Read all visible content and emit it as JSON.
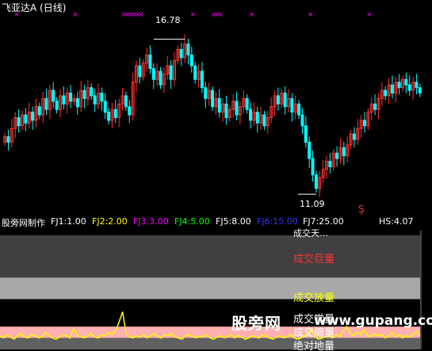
{
  "header": {
    "title": "飞亚达A (日线)"
  },
  "annotations": {
    "high": "16.78",
    "low": "11.09"
  },
  "fj_bar": {
    "items": [
      {
        "text": "股旁网制作",
        "color": "#ffffff"
      },
      {
        "text": "FJ1:1.00",
        "color": "#ffffff"
      },
      {
        "text": "FJ2:2.00",
        "color": "#ffff00"
      },
      {
        "text": "FJ3:3.00",
        "color": "#ff00ff"
      },
      {
        "text": "FJ4:5.00",
        "color": "#00ff00"
      },
      {
        "text": "FJ5:8.00",
        "color": "#ffffff"
      },
      {
        "text": "FJ6:15.00",
        "color": "#3333ff"
      },
      {
        "text": "FJ7:25.00",
        "color": "#ffffff"
      },
      {
        "text": "HS:4.07",
        "color": "#ffffff"
      }
    ]
  },
  "indicator": {
    "labels": {
      "top_partial": "成交天…",
      "huge_volume": "成交巨量",
      "expand_volume": "成交放量",
      "normal_volume": "成交常量",
      "shrink_volume": "成交缩量",
      "absolute_low": "绝对地量"
    }
  },
  "watermark": {
    "text1": "股旁网",
    "text2": "www.gupang.com"
  },
  "colors": {
    "up": "#ff3333",
    "down": "#00ffff",
    "marker": "#ff00ff",
    "line": "#ffff00",
    "band_dark": "#404040",
    "band_light": "#a8a8a8",
    "band_pink": "#ffb0b0"
  },
  "chart_data": [
    {
      "type": "candlestick",
      "title": "飞亚达A (日线)",
      "annotated_high": 16.78,
      "annotated_low": 11.09,
      "ylim": [
        10.6,
        17.4
      ],
      "close": [
        13.2,
        13.0,
        13.5,
        13.9,
        13.6,
        14.0,
        13.7,
        14.1,
        13.8,
        14.3,
        14.0,
        14.6,
        14.2,
        14.9,
        14.5,
        14.2,
        14.7,
        14.4,
        14.8,
        14.5,
        14.6,
        14.3,
        14.9,
        14.6,
        15.0,
        14.7,
        14.4,
        14.8,
        14.5,
        14.1,
        13.8,
        14.2,
        13.9,
        14.4,
        14.7,
        14.3,
        14.0,
        15.2,
        15.8,
        15.4,
        15.9,
        16.2,
        15.7,
        15.3,
        15.6,
        15.1,
        15.5,
        15.8,
        15.3,
        16.0,
        16.4,
        16.1,
        16.6,
        16.2,
        15.8,
        15.3,
        15.6,
        15.0,
        14.6,
        14.9,
        14.3,
        14.6,
        14.1,
        14.4,
        13.9,
        14.2,
        14.5,
        14.0,
        14.3,
        14.6,
        14.2,
        13.8,
        14.1,
        13.7,
        14.0,
        13.6,
        13.9,
        14.3,
        14.7,
        14.4,
        14.8,
        14.3,
        14.6,
        14.1,
        14.4,
        14.0,
        13.6,
        13.0,
        12.4,
        11.8,
        11.3,
        11.7,
        12.0,
        12.3,
        12.1,
        12.6,
        12.4,
        12.8,
        12.5,
        12.9,
        13.3,
        13.1,
        13.5,
        13.8,
        13.6,
        14.1,
        14.4,
        14.2,
        14.6,
        14.9,
        14.7,
        15.1,
        14.8,
        15.2,
        15.0,
        15.3,
        15.1,
        14.9,
        15.2,
        15.0,
        14.8
      ]
    },
    {
      "type": "line",
      "name": "成交量指标",
      "ylim": [
        0,
        10
      ],
      "bands": [
        {
          "label": "成交巨量",
          "from": 6.3,
          "to": 10
        },
        {
          "label": "成交放量",
          "from": 4.4,
          "to": 6.3
        },
        {
          "label": "成交常量",
          "from": 2.0,
          "to": 4.4
        },
        {
          "label": "成交缩量",
          "from": 1.0,
          "to": 2.0
        },
        {
          "label": "绝对地量",
          "from": 0,
          "to": 1.0
        }
      ],
      "values": [
        1.2,
        1.0,
        1.3,
        1.1,
        0.9,
        1.2,
        1.4,
        1.1,
        1.0,
        1.3,
        1.2,
        1.0,
        1.1,
        1.5,
        1.2,
        1.0,
        0.9,
        1.1,
        1.3,
        1.2,
        1.0,
        1.8,
        1.3,
        1.1,
        1.0,
        1.2,
        1.4,
        1.1,
        1.0,
        1.3,
        1.2,
        1.5,
        1.3,
        1.6,
        2.4,
        3.3,
        1.4,
        1.1,
        1.0,
        1.2,
        1.1,
        1.3,
        1.0,
        1.2,
        1.4,
        1.1,
        1.0,
        1.3,
        1.2,
        1.4,
        1.1,
        1.0,
        0.9,
        1.2,
        1.3,
        1.1,
        1.0,
        1.2,
        1.1,
        1.3,
        1.0,
        0.9,
        1.1,
        1.2,
        1.0,
        1.1,
        1.3,
        1.0,
        1.2,
        1.1,
        0.9,
        1.0,
        1.2,
        1.1,
        1.0,
        1.3,
        1.1,
        1.0,
        0.9,
        1.1,
        1.2,
        1.0,
        1.1,
        1.3,
        1.0,
        0.9,
        1.0,
        1.2,
        1.5,
        1.8,
        1.1,
        0.9,
        1.0,
        1.1,
        1.2,
        1.0,
        1.3,
        1.1,
        1.6,
        2.0,
        1.4,
        1.2,
        1.5,
        1.3,
        1.7,
        1.2,
        1.1,
        1.4,
        1.2,
        1.3,
        1.0,
        1.2,
        1.5,
        1.1,
        1.3,
        1.0,
        1.2,
        1.1,
        1.3,
        1.6,
        1.2
      ]
    }
  ]
}
